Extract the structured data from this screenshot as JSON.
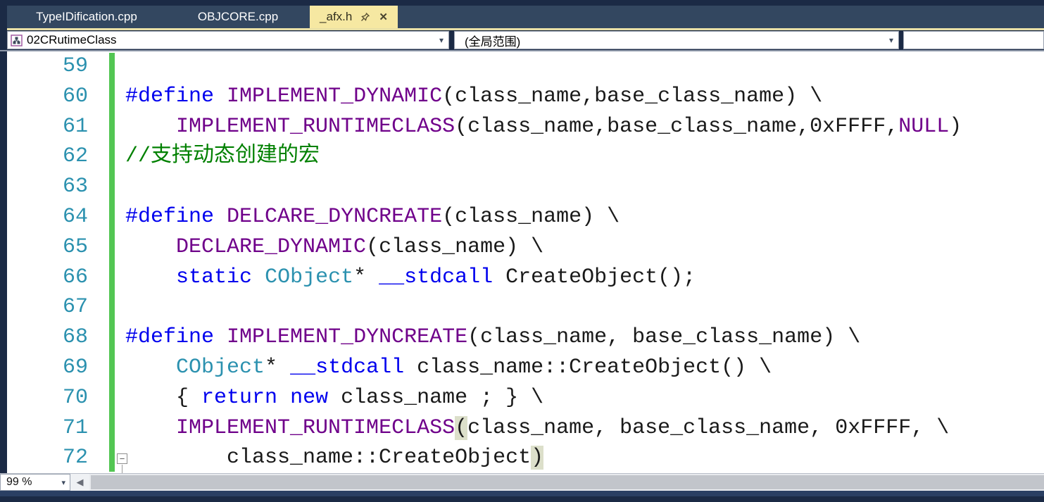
{
  "tabs": [
    {
      "label": "TypeIDification.cpp",
      "active": false
    },
    {
      "label": "OBJCORE.cpp",
      "active": false
    },
    {
      "label": "_afx.h",
      "active": true
    }
  ],
  "navbar": {
    "scope_dropdown": "02CRutimeClass",
    "member_dropdown": "(全局范围)",
    "right_dropdown": ""
  },
  "statusbar": {
    "zoom_level": "99 %"
  },
  "colors": {
    "frame": "#1b2a45",
    "tab_strip": "#334760",
    "active_tab": "#f6e8a2",
    "keyword": "#0000ee",
    "macro": "#6f008a",
    "type": "#2b91af",
    "comment": "#008000",
    "line_number": "#2b91af",
    "change_bar": "#53c653",
    "brace_match": "#dcdfca"
  },
  "editor": {
    "lines": [
      {
        "num": 59,
        "tokens": []
      },
      {
        "num": 60,
        "tokens": [
          [
            "kw",
            "#define"
          ],
          [
            "pl",
            " "
          ],
          [
            "mac",
            "IMPLEMENT_DYNAMIC"
          ],
          [
            "pl",
            "(class_name,base_class_name) \\"
          ]
        ]
      },
      {
        "num": 61,
        "tokens": [
          [
            "pl",
            "    "
          ],
          [
            "mac",
            "IMPLEMENT_RUNTIMECLASS"
          ],
          [
            "pl",
            "(class_name,base_class_name,0xFFFF,"
          ],
          [
            "mac",
            "NULL"
          ],
          [
            "pl",
            ")"
          ]
        ]
      },
      {
        "num": 62,
        "tokens": [
          [
            "com",
            "//支持动态创建的宏"
          ]
        ]
      },
      {
        "num": 63,
        "tokens": []
      },
      {
        "num": 64,
        "tokens": [
          [
            "kw",
            "#define"
          ],
          [
            "pl",
            " "
          ],
          [
            "mac",
            "DELCARE_DYNCREATE"
          ],
          [
            "pl",
            "(class_name) \\"
          ]
        ]
      },
      {
        "num": 65,
        "tokens": [
          [
            "pl",
            "    "
          ],
          [
            "mac",
            "DECLARE_DYNAMIC"
          ],
          [
            "pl",
            "(class_name) \\"
          ]
        ]
      },
      {
        "num": 66,
        "tokens": [
          [
            "pl",
            "    "
          ],
          [
            "kw",
            "static"
          ],
          [
            "pl",
            " "
          ],
          [
            "typ",
            "CObject"
          ],
          [
            "pl",
            "* "
          ],
          [
            "kw",
            "__stdcall"
          ],
          [
            "pl",
            " CreateObject();"
          ]
        ]
      },
      {
        "num": 67,
        "tokens": []
      },
      {
        "num": 68,
        "tokens": [
          [
            "kw",
            "#define"
          ],
          [
            "pl",
            " "
          ],
          [
            "mac",
            "IMPLEMENT_DYNCREATE"
          ],
          [
            "pl",
            "(class_name, base_class_name) \\"
          ]
        ]
      },
      {
        "num": 69,
        "tokens": [
          [
            "pl",
            "    "
          ],
          [
            "typ",
            "CObject"
          ],
          [
            "pl",
            "* "
          ],
          [
            "kw",
            "__stdcall"
          ],
          [
            "pl",
            " class_name::CreateObject() \\"
          ]
        ]
      },
      {
        "num": 70,
        "tokens": [
          [
            "pl",
            "    { "
          ],
          [
            "kw",
            "return"
          ],
          [
            "pl",
            " "
          ],
          [
            "kw",
            "new"
          ],
          [
            "pl",
            " class_name ; } \\"
          ]
        ]
      },
      {
        "num": 71,
        "tokens": [
          [
            "pl",
            "    "
          ],
          [
            "mac",
            "IMPLEMENT_RUNTIMECLASS"
          ],
          [
            "hl",
            "("
          ],
          [
            "pl",
            "class_name, base_class_name, 0xFFFF, \\"
          ]
        ]
      },
      {
        "num": 72,
        "tokens": [
          [
            "pl",
            "        class_name::CreateObject"
          ],
          [
            "hl",
            ")"
          ]
        ]
      }
    ]
  }
}
